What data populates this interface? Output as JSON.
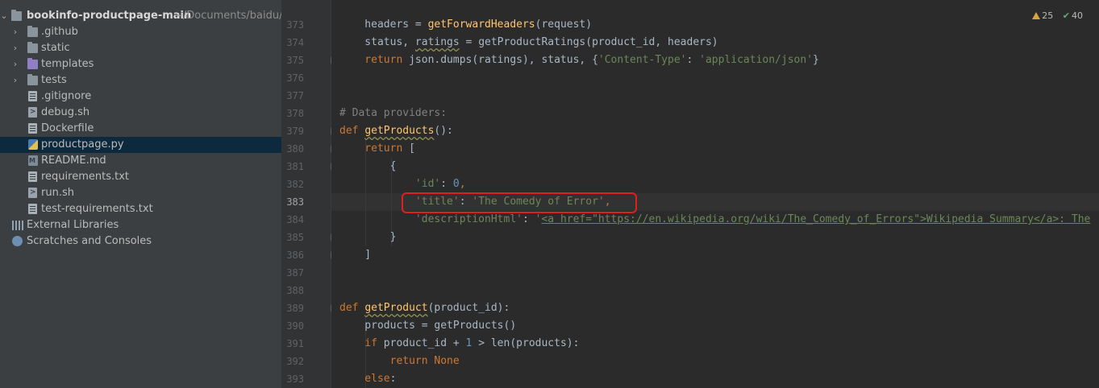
{
  "project": {
    "root_name": "bookinfo-productpage-main",
    "root_path": "~/Documents/baidu/bo",
    "items": [
      {
        "label": "bookinfo-productpage-main",
        "kind": "root"
      },
      {
        "label": ".github",
        "kind": "folder"
      },
      {
        "label": "static",
        "kind": "folder"
      },
      {
        "label": "templates",
        "kind": "folder-purple"
      },
      {
        "label": "tests",
        "kind": "folder"
      },
      {
        "label": ".gitignore",
        "kind": "file"
      },
      {
        "label": "debug.sh",
        "kind": "sh"
      },
      {
        "label": "Dockerfile",
        "kind": "file"
      },
      {
        "label": "productpage.py",
        "kind": "py"
      },
      {
        "label": "README.md",
        "kind": "md"
      },
      {
        "label": "requirements.txt",
        "kind": "file"
      },
      {
        "label": "run.sh",
        "kind": "sh"
      },
      {
        "label": "test-requirements.txt",
        "kind": "file"
      },
      {
        "label": "External Libraries",
        "kind": "lib"
      },
      {
        "label": "Scratches and Consoles",
        "kind": "scratch"
      }
    ]
  },
  "inspections": {
    "warnings": "25",
    "ok": "40"
  },
  "editor": {
    "line_numbers": [
      "373",
      "374",
      "375",
      "376",
      "377",
      "378",
      "379",
      "380",
      "381",
      "382",
      "383",
      "384",
      "385",
      "386",
      "387",
      "388",
      "389",
      "390",
      "391",
      "392",
      "393"
    ],
    "lines": {
      "l373_a": "    headers = ",
      "l373_fn": "getForwardHeaders",
      "l373_b": "(request)",
      "l374_a": "    status, ",
      "l374_rt": "ratings",
      "l374_b": " = ",
      "l374_fn": "getProductRatings",
      "l374_c": "(product_id, headers)",
      "l375_kw": "    return ",
      "l375_a": "json.dumps(ratings), status, {",
      "l375_s1": "'Content-Type'",
      "l375_b": ": ",
      "l375_s2": "'application/json'",
      "l375_c": "}",
      "l378_cmt": "# Data providers:",
      "l379_kw": "def ",
      "l379_fn": "getProducts",
      "l379_a": "():",
      "l380_kw": "    return ",
      "l380_a": "[",
      "l381_a": "        {",
      "l382_s1": "            'id'",
      "l382_a": ": ",
      "l382_n": "0",
      "l382_b": ",",
      "l383_s1": "            'title'",
      "l383_a": ": ",
      "l383_s2": "'The Comedy of Error'",
      "l383_b": ",",
      "l384_s1": "            'descriptionHtml'",
      "l384_a": ": ",
      "l384_s2": "'",
      "l384_h": "<a href=\"https://en.wikipedia.org/wiki/The_Comedy_of_Errors\">Wikipedia Summary</a>: The",
      "l385_a": "        }",
      "l386_a": "    ]",
      "l389_kw": "def ",
      "l389_fn": "getProduct",
      "l389_a": "(product_id):",
      "l390_a": "    products = ",
      "l390_fn": "getProducts",
      "l390_b": "()",
      "l391_kw": "    if ",
      "l391_a": "product_id + ",
      "l391_n": "1",
      "l391_b": " > len(products):",
      "l392_kw": "        return ",
      "l392_kw2": "None",
      "l393_kw": "    else",
      "l393_a": ":"
    }
  },
  "colors": {
    "keyword": "#cc7832",
    "function": "#ffc66d",
    "string": "#6a8759",
    "number": "#6897bb",
    "highlight": "#e02020"
  }
}
